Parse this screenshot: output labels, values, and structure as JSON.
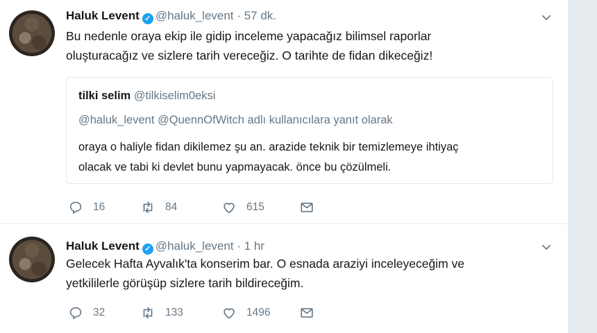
{
  "tweets": [
    {
      "name": "Haluk Levent",
      "handle": "@haluk_levent",
      "separator": "·",
      "time": "57 dk.",
      "text": "Bu nedenle oraya ekip ile gidip inceleme yapacağız bilimsel raporlar\noluşturacağız ve sizlere tarih vereceğiz. O tarihte de fidan dikeceğiz!",
      "quote": {
        "name": "tilki selim",
        "handle": "@tilkiselim0eksi",
        "reply_to": "@haluk_levent @QuennOfWitch adlı kullanıcılara yanıt olarak",
        "text": "oraya o haliyle fidan dikilemez şu an. arazide teknik bir temizlemeye ihtiyaç\nolacak ve tabi ki devlet bunu yapmayacak. önce bu çözülmeli."
      },
      "replies": "16",
      "retweets": "84",
      "likes": "615"
    },
    {
      "name": "Haluk Levent",
      "handle": "@haluk_levent",
      "separator": "·",
      "time": "1 hr",
      "text": "Gelecek Hafta Ayvalık'ta konserim bar. O esnada araziyi inceleyeceğim ve\nyetkililerle görüşüp sizlere tarih bildireceğim.",
      "replies": "32",
      "retweets": "133",
      "likes": "1496"
    }
  ],
  "icons": {
    "verified": "verified-badge-icon",
    "reply": "reply-icon",
    "retweet": "retweet-icon",
    "like": "heart-icon",
    "dm": "envelope-icon",
    "more": "chevron-down-icon"
  },
  "colors": {
    "accent": "#1da1f2",
    "muted": "#657786",
    "border": "#e6ecf0"
  }
}
